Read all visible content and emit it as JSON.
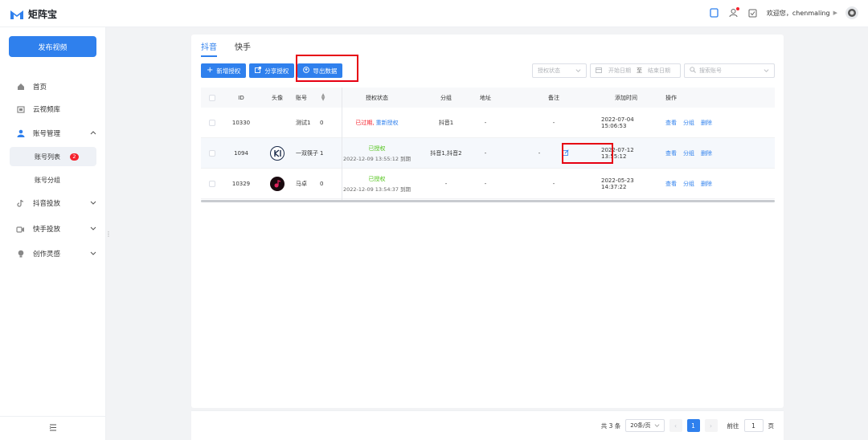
{
  "app": {
    "name": "矩阵宝"
  },
  "header": {
    "welcome": "欢迎您，chenmaling"
  },
  "sidebar": {
    "publish_label": "发布视频",
    "items": [
      {
        "label": "首页"
      },
      {
        "label": "云视频库"
      },
      {
        "label": "账号管理"
      },
      {
        "label": "抖音投放"
      },
      {
        "label": "快手投放"
      },
      {
        "label": "创作灵感"
      }
    ],
    "sub_items": [
      {
        "label": "账号列表",
        "badge": "2"
      },
      {
        "label": "账号分组"
      }
    ]
  },
  "tabs": [
    {
      "label": "抖音"
    },
    {
      "label": "快手"
    }
  ],
  "toolbar": {
    "add_label": "新增授权",
    "share_label": "分享授权",
    "export_label": "导出数据"
  },
  "filters": {
    "status_placeholder": "授权状态",
    "start_placeholder": "开始日期",
    "separator": "至",
    "end_placeholder": "结束日期",
    "search_placeholder": "搜索账号"
  },
  "table": {
    "headers": [
      "ID",
      "头像",
      "账号",
      "授权状态",
      "分组",
      "地址",
      "备注",
      "添加时间",
      "操作"
    ],
    "rows": [
      {
        "id": "10330",
        "account": "测试1",
        "num": "0",
        "status": "已过期,",
        "status_link": "重新授权",
        "status_sub": "",
        "group": "抖音1",
        "address": "-",
        "note": "-",
        "time": "2022-07-04 15:06:53"
      },
      {
        "id": "1094",
        "account": "一双筷子",
        "num": "1",
        "status": "已授权",
        "status_link": "",
        "status_sub": "2022-12-09 13:55:12 到期",
        "group": "抖音1,抖音2",
        "address": "-",
        "note": "-",
        "time": "2022-07-12 13:55:12"
      },
      {
        "id": "10329",
        "account": "马卓",
        "num": "0",
        "status": "已授权",
        "status_link": "",
        "status_sub": "2022-12-09 13:54:37 到期",
        "group": "-",
        "address": "-",
        "note": "-",
        "time": "2022-05-23 14:37:22"
      }
    ],
    "ops": [
      "查看",
      "分组",
      "删除"
    ]
  },
  "pager": {
    "total": "共 3 条",
    "page_size": "20条/页",
    "current": "1",
    "goto_label": "前往",
    "goto_value": "1",
    "page_unit": "页"
  },
  "colors": {
    "accent": "#2f80ed",
    "danger": "#f5222d",
    "success": "#52c41a",
    "highlight": "#e60012"
  }
}
